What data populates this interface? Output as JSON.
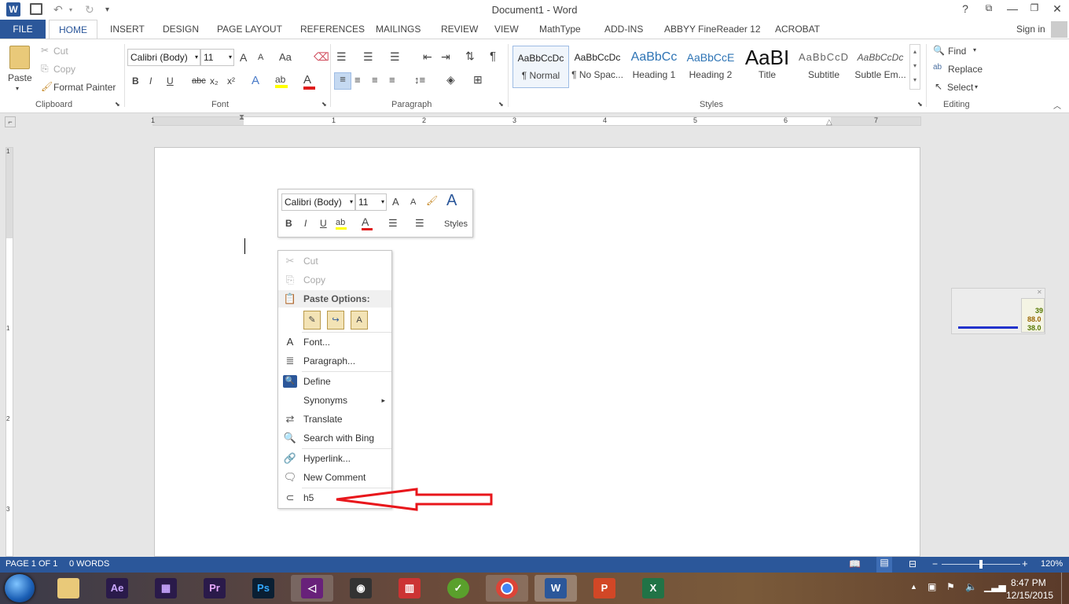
{
  "titlebar": {
    "title": "Document1 - Word",
    "help": "?"
  },
  "tabs": [
    "FILE",
    "HOME",
    "INSERT",
    "DESIGN",
    "PAGE LAYOUT",
    "REFERENCES",
    "MAILINGS",
    "REVIEW",
    "VIEW",
    "MathType",
    "ADD-INS",
    "ABBYY FineReader 12",
    "ACROBAT"
  ],
  "signin": "Sign in",
  "clipboard": {
    "paste": "Paste",
    "cut": "Cut",
    "copy": "Copy",
    "format_painter": "Format Painter",
    "label": "Clipboard"
  },
  "font": {
    "name": "Calibri (Body)",
    "size": "11",
    "label": "Font",
    "bold": "B",
    "italic": "I",
    "underline": "U",
    "strike": "abc",
    "sub": "x₂",
    "sup": "x²",
    "grow": "A",
    "shrink": "A",
    "case": "Aa",
    "effects": "A",
    "highlight": "ab",
    "color": "A"
  },
  "paragraph": {
    "label": "Paragraph",
    "pilcrow": "¶"
  },
  "styles": {
    "label": "Styles",
    "items": [
      {
        "preview": "AaBbCcDc",
        "name": "¶ Normal"
      },
      {
        "preview": "AaBbCcDc",
        "name": "¶ No Spac..."
      },
      {
        "preview": "AaBbCc",
        "name": "Heading 1"
      },
      {
        "preview": "AaBbCcE",
        "name": "Heading 2"
      },
      {
        "preview": "AaBI",
        "name": "Title"
      },
      {
        "preview": "AaBbCcD",
        "name": "Subtitle"
      },
      {
        "preview": "AaBbCcDc",
        "name": "Subtle Em..."
      }
    ]
  },
  "editing": {
    "find": "Find",
    "replace": "Replace",
    "select": "Select",
    "label": "Editing"
  },
  "ruler_numbers": [
    "1",
    "1",
    "2",
    "3",
    "4",
    "5",
    "6",
    "7"
  ],
  "vruler_numbers": [
    "1",
    "1",
    "2",
    "3"
  ],
  "mini_toolbar": {
    "font": "Calibri (Body)",
    "size": "11",
    "styles": "Styles",
    "bold": "B",
    "italic": "I",
    "underline": "U"
  },
  "context_menu": {
    "cut": "Cut",
    "copy": "Copy",
    "paste_options": "Paste Options:",
    "font": "Font...",
    "paragraph": "Paragraph...",
    "define": "Define",
    "synonyms": "Synonyms",
    "translate": "Translate",
    "search_bing": "Search with Bing",
    "hyperlink": "Hyperlink...",
    "new_comment": "New Comment",
    "h5": "h5"
  },
  "widget": {
    "v1": "39",
    "v2": "88.0",
    "v3": "38.0"
  },
  "status": {
    "page": "PAGE 1 OF 1",
    "words": "0 WORDS",
    "zoom": "120%",
    "minus": "−",
    "plus": "+"
  },
  "taskbar": {
    "time": "8:47 PM",
    "date": "12/15/2015"
  },
  "colors": {
    "word_blue": "#2b579a",
    "arrow_red": "#e8161b"
  }
}
